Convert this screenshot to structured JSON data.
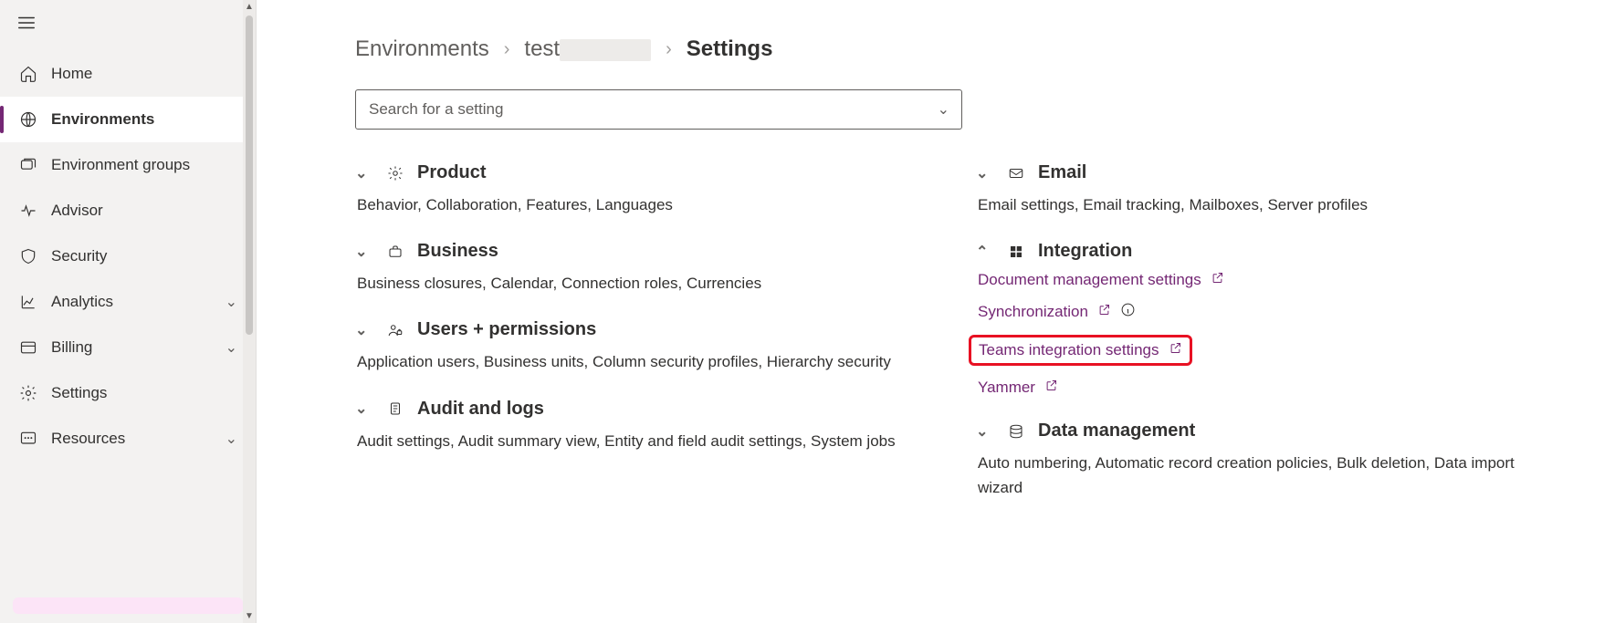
{
  "sidebar": {
    "items": [
      {
        "label": "Home"
      },
      {
        "label": "Environments"
      },
      {
        "label": "Environment groups"
      },
      {
        "label": "Advisor"
      },
      {
        "label": "Security"
      },
      {
        "label": "Analytics"
      },
      {
        "label": "Billing"
      },
      {
        "label": "Settings"
      },
      {
        "label": "Resources"
      }
    ]
  },
  "breadcrumb": {
    "environments": "Environments",
    "env_name": "test",
    "current": "Settings"
  },
  "search": {
    "placeholder": "Search for a setting"
  },
  "left_sections": [
    {
      "title": "Product",
      "sub": "Behavior, Collaboration, Features, Languages",
      "expanded": false
    },
    {
      "title": "Business",
      "sub": "Business closures, Calendar, Connection roles, Currencies",
      "expanded": false
    },
    {
      "title": "Users + permissions",
      "sub": "Application users, Business units, Column security profiles, Hierarchy security",
      "expanded": false
    },
    {
      "title": "Audit and logs",
      "sub": "Audit settings, Audit summary view, Entity and field audit settings, System jobs",
      "expanded": false
    }
  ],
  "right_sections": {
    "email": {
      "title": "Email",
      "sub": "Email settings, Email tracking, Mailboxes, Server profiles",
      "expanded": false
    },
    "integration": {
      "title": "Integration",
      "expanded": true,
      "links": [
        {
          "label": "Document management settings",
          "info": false
        },
        {
          "label": "Synchronization",
          "info": true
        },
        {
          "label": "Teams integration settings",
          "info": false,
          "highlight": true
        },
        {
          "label": "Yammer",
          "info": false
        }
      ]
    },
    "data": {
      "title": "Data management",
      "sub": "Auto numbering, Automatic record creation policies, Bulk deletion, Data import wizard",
      "expanded": false
    }
  }
}
